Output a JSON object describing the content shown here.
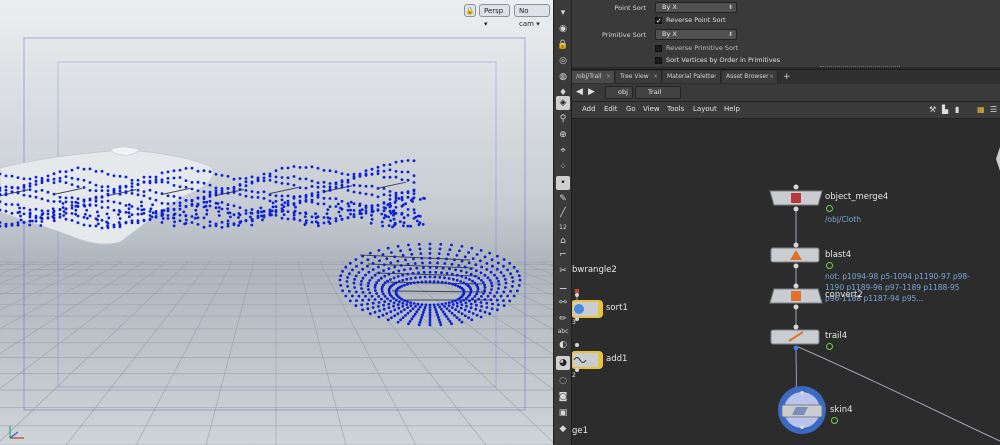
{
  "viewport": {
    "camera_menu": "Persp",
    "cam_menu": "No cam",
    "accent_color": "#0b1fd6"
  },
  "params": {
    "point_sort_label": "Point Sort",
    "point_sort_value": "By X",
    "reverse_point_sort_label": "Reverse Point Sort",
    "reverse_point_sort_checked": true,
    "primitive_sort_label": "Primitive Sort",
    "primitive_sort_value": "By X",
    "reverse_primitive_sort_label": "Reverse Primitive Sort",
    "reverse_primitive_sort_checked": false,
    "sort_vertices_label": "Sort Vertices by Order in Primitives",
    "sort_vertices_checked": false
  },
  "tabs": [
    {
      "label": "/obj/Trail",
      "active": true
    },
    {
      "label": "Tree View"
    },
    {
      "label": "Material Palette"
    },
    {
      "label": "Asset Browser"
    },
    {
      "label": "+"
    }
  ],
  "path": {
    "obj": "obj",
    "trail": "Trail"
  },
  "menu": [
    "Add",
    "Edit",
    "Go",
    "View",
    "Tools",
    "Layout",
    "Help"
  ],
  "network": {
    "left_partial_nodes": {
      "bwrangle": "bwrangle2",
      "sort": "sort1",
      "sort_badge": "3",
      "add": "add1",
      "add_badge": "2",
      "ge": "ge1"
    },
    "nodes": {
      "object_merge": {
        "name": "object_merge4",
        "sub": "/obj/Cloth"
      },
      "blast": {
        "name": "blast4",
        "sub": "not: p1094-98 p5-1094 p1190-97 p98-1190 p1189-96 p97-1189 p1188-95 p96-1188 p1187-94 p95..."
      },
      "convert": {
        "name": "convert2"
      },
      "trail": {
        "name": "trail4"
      },
      "skin": {
        "name": "skin4"
      }
    }
  }
}
